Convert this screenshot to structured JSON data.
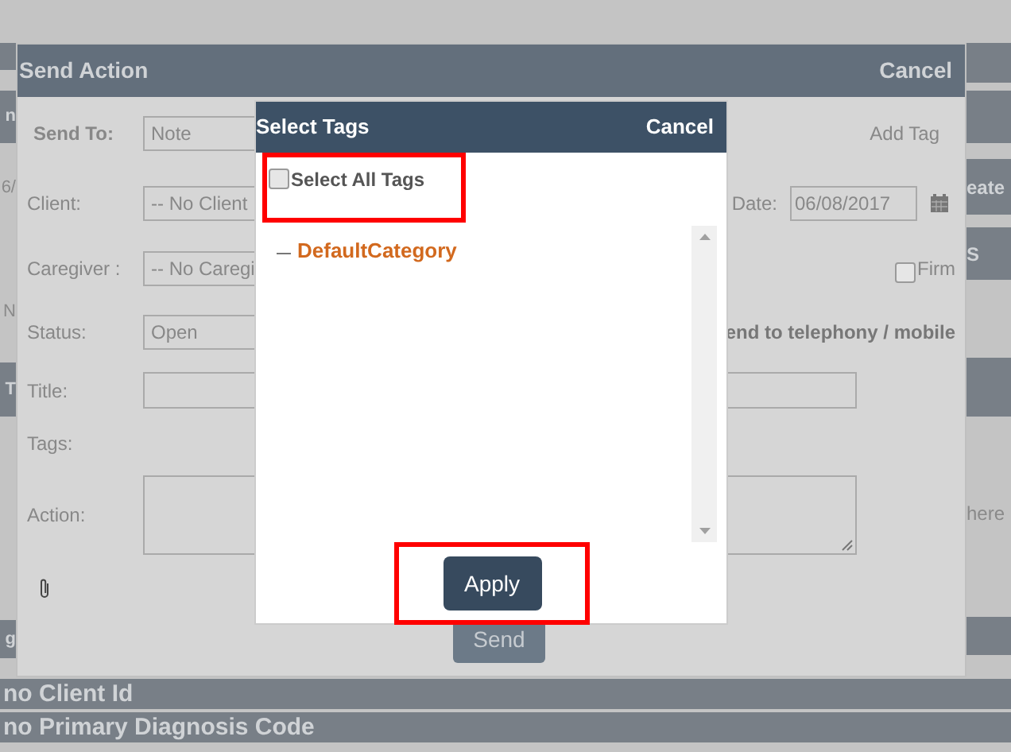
{
  "background": {
    "left_fragments": [
      {
        "text": "n",
        "kind": "dark"
      },
      {
        "text": "6/",
        "kind": "light"
      },
      {
        "text": "N",
        "kind": "light"
      },
      {
        "text": "T",
        "kind": "dark"
      },
      {
        "text": "g",
        "kind": "dark"
      }
    ],
    "right_fragments": [
      {
        "text": "eate",
        "kind": "dark"
      },
      {
        "text": "S",
        "kind": "dark"
      },
      {
        "text": "here",
        "kind": "light"
      }
    ],
    "bottom_rows": [
      "no Client Id",
      "no Primary Diagnosis Code"
    ]
  },
  "send_action": {
    "title": "Send Action",
    "cancel": "Cancel",
    "fields": [
      {
        "kind": "select",
        "label": "Send To:",
        "value": "Note"
      },
      {
        "kind": "select",
        "label": "Client:",
        "value": "-- No Client"
      },
      {
        "kind": "select",
        "label": "Caregiver :",
        "value": "-- No Caregi"
      },
      {
        "kind": "select",
        "label": "Status:",
        "value": "Open"
      },
      {
        "kind": "text",
        "label": "Title:"
      },
      {
        "kind": "label",
        "label": "Tags:"
      },
      {
        "kind": "textarea",
        "label": "Action:"
      }
    ],
    "add_tag": "Add Tag",
    "date": {
      "label": "Date:",
      "value": "06/08/2017"
    },
    "firm": {
      "label": "Firm",
      "checked": false
    },
    "telephony": "end to telephony / mobile",
    "send": "Send"
  },
  "select_tags": {
    "title": "Select Tags",
    "cancel": "Cancel",
    "select_all": {
      "label": "Select All Tags",
      "checked": false
    },
    "tags": [
      {
        "label": "DefaultCategory"
      }
    ],
    "apply": "Apply"
  }
}
